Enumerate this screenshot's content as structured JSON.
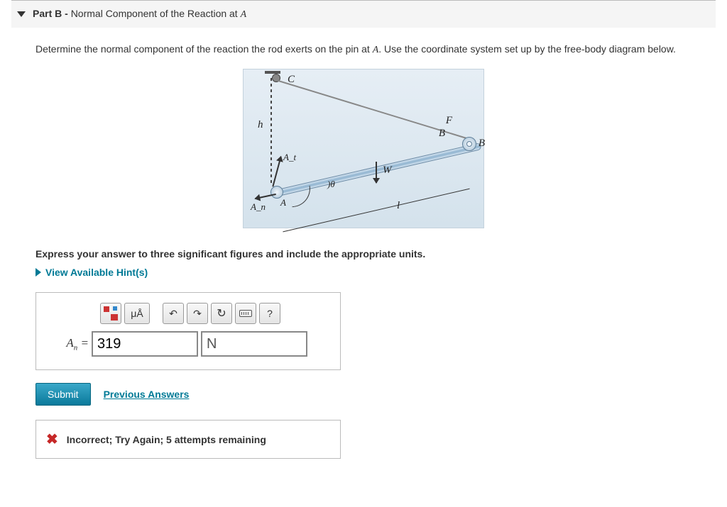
{
  "header": {
    "part_label": "Part B -",
    "part_title": "Normal Component of the Reaction at ",
    "part_point": "A"
  },
  "prompt": {
    "before": "Determine the normal component of the reaction the rod exerts on the pin at ",
    "pointA": "A",
    "after": ". Use the coordinate system set up by the free-body diagram below."
  },
  "diagram": {
    "C": "C",
    "h": "h",
    "F": "F",
    "B_left": "B",
    "B_right": "B",
    "W": "W",
    "l": "l",
    "theta": "θ",
    "At": "A_t",
    "An": "A_n",
    "A": "A"
  },
  "instruct": "Express your answer to three significant figures and include the appropriate units.",
  "hints": "View Available Hint(s)",
  "toolbar": {
    "units": "μÅ",
    "undo": "↶",
    "redo": "↷",
    "reset": "↻",
    "help": "?"
  },
  "answer": {
    "label_var": "A",
    "label_sub": "n",
    "equals": " = ",
    "value": "319",
    "unit": "N"
  },
  "submit": "Submit",
  "previous": "Previous Answers",
  "feedback": "Incorrect; Try Again; 5 attempts remaining"
}
